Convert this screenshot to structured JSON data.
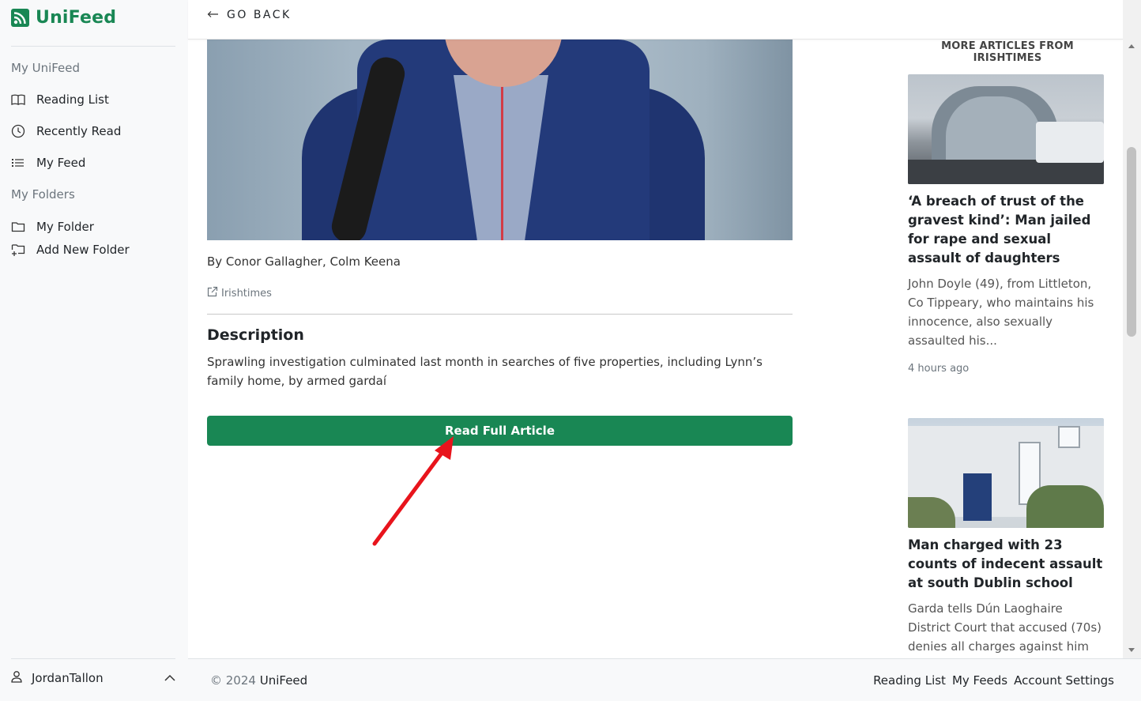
{
  "brand": {
    "name": "UniFeed"
  },
  "sidebar": {
    "section_feed": "My UniFeed",
    "items": [
      {
        "label": "Reading List",
        "icon": "book-icon"
      },
      {
        "label": "Recently Read",
        "icon": "clock-icon"
      },
      {
        "label": "My Feed",
        "icon": "list-icon"
      }
    ],
    "section_folders": "My Folders",
    "folders": [
      {
        "label": "My Folder",
        "icon": "folder-icon"
      },
      {
        "label": "Add New Folder",
        "icon": "folder-plus-icon"
      }
    ],
    "user": {
      "name": "JordanTallon",
      "icon": "person-icon"
    }
  },
  "topbar": {
    "go_back": "GO BACK"
  },
  "article": {
    "byline": "By Conor Gallagher, Colm Keena",
    "source": "Irishtimes",
    "description_heading": "Description",
    "description": "Sprawling investigation culminated last month in searches of five properties, including Lynn’s family home, by armed gardaí",
    "read_button": "Read Full Article"
  },
  "more": {
    "heading": "MORE ARTICLES FROM IRISHTIMES",
    "cards": [
      {
        "title": "‘A breach of trust of the gravest kind’: Man jailed for rape and sexual assault of daughters",
        "desc": "John Doyle (49), from Littleton, Co Tippeary, who maintains his innocence, also sexually assaulted his...",
        "time": "4 hours ago"
      },
      {
        "title": "Man charged with 23 counts of indecent assault at south Dublin school",
        "desc": "Garda tells Dún Laoghaire District Court that accused (70s) denies all charges against him",
        "time": ""
      }
    ]
  },
  "footer": {
    "copyright_symbol": "© 2024",
    "brand": "UniFeed",
    "links": [
      "Reading List",
      "My Feeds",
      "Account Settings"
    ]
  },
  "colors": {
    "brand_green": "#198754",
    "annotation_red": "#e8141c"
  }
}
